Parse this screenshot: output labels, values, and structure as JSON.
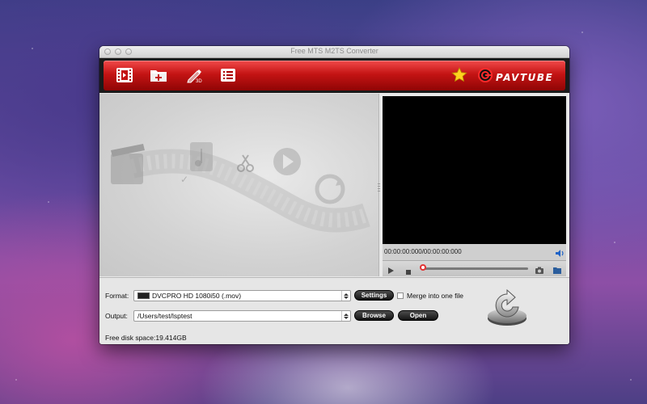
{
  "window": {
    "title": "Free MTS M2TS Converter"
  },
  "toolbar": {
    "buttons": [
      {
        "name": "add-video",
        "icon": "film-icon"
      },
      {
        "name": "add-folder",
        "icon": "folder-plus-icon"
      },
      {
        "name": "edit",
        "icon": "pencil-3d-icon"
      },
      {
        "name": "task-list",
        "icon": "list-icon"
      }
    ],
    "favorite_icon": "star-icon",
    "brand_text": "PAVTUBE",
    "accent_color": "#c41414"
  },
  "preview": {
    "timecode": "00:00:00:000/00:00:00:000",
    "seek_position": 0
  },
  "bottom": {
    "format_label": "Format:",
    "format_value": "DVCPRO HD 1080i50 (.mov)",
    "settings_label": "Settings",
    "merge_label": "Merge into one file",
    "merge_checked": false,
    "output_label": "Output:",
    "output_value": "/Users/test/lsptest",
    "browse_label": "Browse",
    "open_label": "Open",
    "disk_space": "Free disk space:19.414GB"
  }
}
